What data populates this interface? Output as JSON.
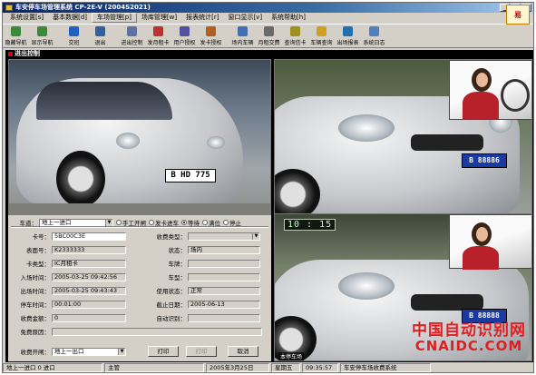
{
  "window": {
    "title": "车安停车场管理系统 CP-2E-V (2004S2021)"
  },
  "menu": [
    "系统设置[s]",
    "基本数据[d]",
    "车场管理[p]",
    "场库管理[w]",
    "报表统计[r]",
    "窗口显示[v]",
    "系统帮助[h]"
  ],
  "toolbar": [
    {
      "label": "隐藏导航",
      "icon": "hide-nav-icon",
      "color": "#3a8a3a"
    },
    {
      "label": "显示导航",
      "icon": "show-nav-icon",
      "color": "#3a8a3a"
    },
    {
      "label": "交班",
      "icon": "shift-change-icon",
      "color": "#2060c0"
    },
    {
      "label": "退出",
      "icon": "exit-icon",
      "color": "#3060a0"
    },
    {
      "label": "进出控制",
      "icon": "access-control-icon",
      "color": "#6070a0"
    },
    {
      "label": "发月租卡",
      "icon": "issue-card-icon",
      "color": "#c03030"
    },
    {
      "label": "用户授权",
      "icon": "user-auth-icon",
      "color": "#5050a0"
    },
    {
      "label": "发卡授权",
      "icon": "card-auth-icon",
      "color": "#b06020"
    },
    {
      "label": "场内车辆",
      "icon": "parked-cars-icon",
      "color": "#4070b0"
    },
    {
      "label": "月租交费",
      "icon": "monthly-fee-icon",
      "color": "#6a6a6a"
    },
    {
      "label": "查询信卡",
      "icon": "query-card-icon",
      "color": "#a09020"
    },
    {
      "label": "车辆查询",
      "icon": "vehicle-query-icon",
      "color": "#d0a020"
    },
    {
      "label": "出场报表",
      "icon": "exit-report-icon",
      "color": "#2070b0"
    },
    {
      "label": "系统日志",
      "icon": "system-log-icon",
      "color": "#5080c0"
    }
  ],
  "panel": {
    "title": "进出控制"
  },
  "form": {
    "lane_label": "车道：",
    "lane_value": "地上一进口",
    "radios": [
      {
        "label": "手工开闸",
        "checked": false
      },
      {
        "label": "发卡进车",
        "checked": false
      },
      {
        "label": "等待",
        "checked": true
      },
      {
        "label": "满位",
        "checked": false
      },
      {
        "label": "停止",
        "checked": false
      }
    ],
    "fields_left": [
      {
        "label": "卡号：",
        "value": "5BC00C3E"
      },
      {
        "label": "表面号：",
        "value": "K2333333"
      },
      {
        "label": "卡类型：",
        "value": "IC月租卡"
      },
      {
        "label": "入场时间：",
        "value": "2005-03-25 09:42:56"
      },
      {
        "label": "出场时间：",
        "value": "2005-03-25 09:43:43"
      },
      {
        "label": "停车时间：",
        "value": "00:01:00"
      },
      {
        "label": "收费金额：",
        "value": "0"
      },
      {
        "label": "免费原因：",
        "value": ""
      }
    ],
    "fields_right": [
      {
        "label": "收费类型：",
        "value": ""
      },
      {
        "label": "状态：",
        "value": "场内"
      },
      {
        "label": "车牌：",
        "value": ""
      },
      {
        "label": "车型：",
        "value": ""
      },
      {
        "label": "使用状态：",
        "value": "正常"
      },
      {
        "label": "截止日期：",
        "value": "2005-06-13"
      },
      {
        "label": "自动识别：",
        "value": ""
      }
    ],
    "charge_gate_label": "收费开闸：",
    "charge_gate_value": "地上一出口",
    "buttons": {
      "confirm": "打印",
      "print": "打印",
      "cancel": "取消"
    }
  },
  "cameras": {
    "cam1_plate": "B HD 775",
    "cam2_plate": "B 88886",
    "cam3_plate": "B 88888",
    "clock": "10 : 15",
    "cam3_label": "本停车场"
  },
  "status": {
    "lane": "地上一进口 0 进口",
    "operator": "主管",
    "date": "2005年3月25日",
    "weekday": "星期五",
    "time": "09:35:57",
    "company": "车安停车场收费系统"
  },
  "watermark": {
    "line1": "中国自动识别网",
    "line2": "CNAIDC.COM"
  }
}
